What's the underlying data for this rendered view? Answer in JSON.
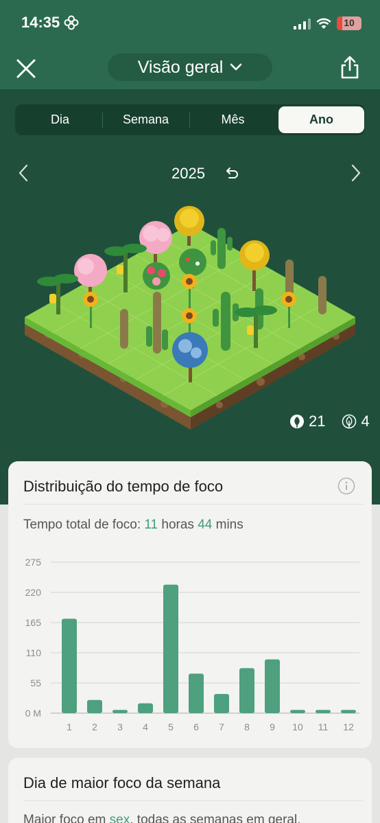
{
  "status_bar": {
    "time": "14:35",
    "battery": "10"
  },
  "nav": {
    "title": "Visão geral"
  },
  "tabs": [
    {
      "label": "Dia",
      "active": false
    },
    {
      "label": "Semana",
      "active": false
    },
    {
      "label": "Mês",
      "active": false
    },
    {
      "label": "Ano",
      "active": true
    }
  ],
  "period": {
    "year": "2025"
  },
  "forest_counts": {
    "healthy": "21",
    "withered": "4"
  },
  "focus_card": {
    "title": "Distribuição do tempo de foco",
    "total_prefix": "Tempo total de foco: ",
    "hours": "11",
    "hours_label": " horas ",
    "mins": "44",
    "mins_label": " mins"
  },
  "chart_data": {
    "type": "bar",
    "categories": [
      "1",
      "2",
      "3",
      "4",
      "5",
      "6",
      "7",
      "8",
      "9",
      "10",
      "11",
      "12"
    ],
    "values": [
      172,
      24,
      6,
      18,
      234,
      72,
      35,
      82,
      98,
      6,
      6,
      6
    ],
    "yticks": [
      "0 M",
      "55",
      "110",
      "165",
      "220",
      "275"
    ],
    "ylim": [
      0,
      275
    ],
    "bar_color": "#4ea07f",
    "grid": true
  },
  "week_card": {
    "title": "Dia de maior foco da semana",
    "prefix": "Maior foco em ",
    "day": "sex",
    "suffix": ", todas as semanas em geral."
  },
  "colors": {
    "accent": "#3f9c78",
    "header": "#2b6a4f",
    "background": "#20503c"
  }
}
